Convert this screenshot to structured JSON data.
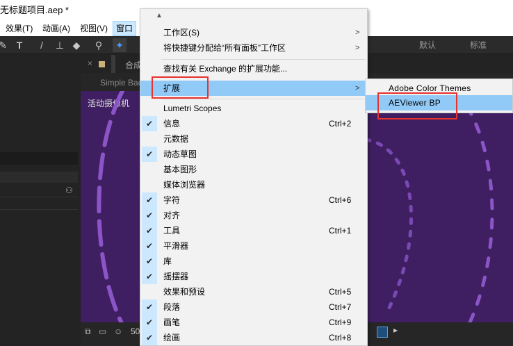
{
  "window": {
    "title": "无标题项目.aep *"
  },
  "menubar": {
    "items": [
      {
        "label": "效果(T)"
      },
      {
        "label": "动画(A)"
      },
      {
        "label": "视图(V)"
      },
      {
        "label": "窗口"
      }
    ]
  },
  "toolbar": {
    "tools": [
      "pen-tool-icon",
      "text-tool-icon",
      "brush-tool-icon",
      "clone-stamp-icon",
      "eraser-icon",
      "roto-brush-icon",
      "pin-tool-icon"
    ],
    "workspaces": {
      "default": "默认",
      "standard": "标准"
    }
  },
  "comp_panel": {
    "tab_label": "合成",
    "sub_label": "Simple Bac",
    "camera_label": "活动摄像机",
    "bottom_zoom": "50",
    "bg_color": "#3f1f61",
    "dash_color": "#8b55c8"
  },
  "window_menu": {
    "items": [
      {
        "label": "工作区(S)",
        "submenu": true
      },
      {
        "label": "将快捷键分配给“所有面板”工作区",
        "submenu": true
      },
      {
        "label": "查找有关 Exchange 的扩展功能..."
      },
      {
        "label": "扩展",
        "submenu": true,
        "highlighted": true
      },
      {
        "label": "Lumetri Scopes"
      },
      {
        "label": "信息",
        "checked": true,
        "shortcut": "Ctrl+2"
      },
      {
        "label": "元数据"
      },
      {
        "label": "动态草图",
        "checked": true
      },
      {
        "label": "基本图形"
      },
      {
        "label": "媒体浏览器"
      },
      {
        "label": "字符",
        "checked": true,
        "shortcut": "Ctrl+6"
      },
      {
        "label": "对齐",
        "checked": true
      },
      {
        "label": "工具",
        "checked": true,
        "shortcut": "Ctrl+1"
      },
      {
        "label": "平滑器",
        "checked": true
      },
      {
        "label": "库",
        "checked": true
      },
      {
        "label": "摇摆器",
        "checked": true
      },
      {
        "label": "效果和预设",
        "shortcut": "Ctrl+5"
      },
      {
        "label": "段落",
        "checked": true,
        "shortcut": "Ctrl+7"
      },
      {
        "label": "画笔",
        "checked": true,
        "shortcut": "Ctrl+9"
      },
      {
        "label": "绘画",
        "checked": true,
        "shortcut": "Ctrl+8"
      }
    ]
  },
  "extensions_submenu": {
    "items": [
      {
        "label": "Adobe Color Themes"
      },
      {
        "label": "AEViewer BP",
        "highlighted": true
      }
    ]
  },
  "colors": {
    "highlight": "#91c9f7",
    "annotation_red": "#e8322e"
  }
}
